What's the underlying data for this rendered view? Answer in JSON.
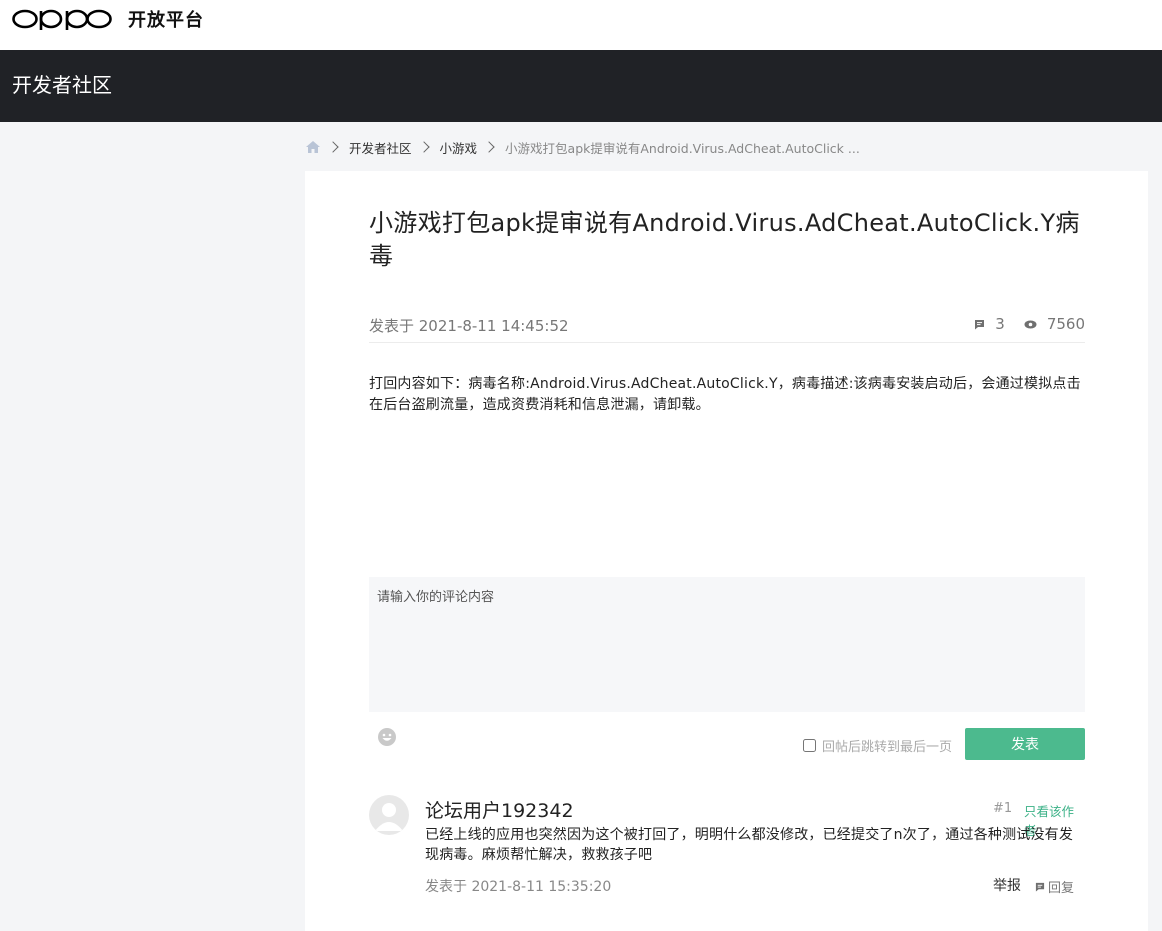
{
  "header": {
    "logo_text": "oppo",
    "brand_name": "开放平台"
  },
  "community_bar": {
    "title": "开发者社区"
  },
  "breadcrumb": {
    "items": [
      "开发者社区",
      "小游戏"
    ],
    "current": "小游戏打包apk提审说有Android.Virus.AdCheat.AutoClick ..."
  },
  "post": {
    "title": "小游戏打包apk提审说有Android.Virus.AdCheat.AutoClick.Y病毒",
    "published_at": "发表于 2021-8-11 14:45:52",
    "comment_count": "3",
    "view_count": "7560",
    "body": "打回内容如下：病毒名称:Android.Virus.AdCheat.AutoClick.Y，病毒描述:该病毒安装启动后，会通过模拟点击在后台盗刷流量，造成资费消耗和信息泄漏，请卸载。"
  },
  "comment_form": {
    "placeholder": "请输入你的评论内容",
    "jump_label": "回帖后跳转到最后一页",
    "submit_label": "发表"
  },
  "replies": [
    {
      "username": "论坛用户192342",
      "floor": "#1",
      "author_only_label": "只看该作者",
      "body": "已经上线的应用也突然因为这个被打回了，明明什么都没修改，已经提交了n次了，通过各种测试没有发现病毒。麻烦帮忙解决，救救孩子吧",
      "published_at": "发表于 2021-8-11 15:35:20",
      "report_label": "举报",
      "reply_label": "回复"
    }
  ],
  "colors": {
    "accent_green": "#4cba8e",
    "dark_bar": "#202226",
    "page_bg": "#f4f5f7"
  },
  "icons": [
    "home-icon",
    "comment-icon",
    "eye-icon",
    "emoji-icon",
    "reply-icon"
  ]
}
